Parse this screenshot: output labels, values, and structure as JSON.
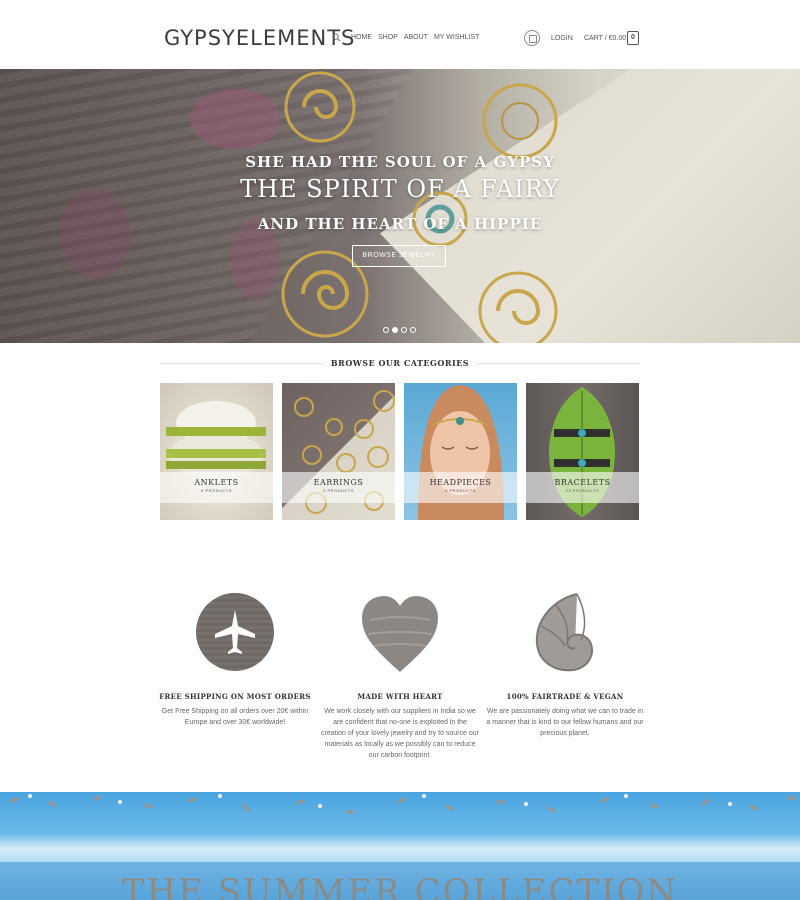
{
  "header": {
    "logo": "GYPSYELEMENTS",
    "nav": [
      "HOME",
      "SHOP",
      "ABOUT",
      "MY WISHLIST"
    ],
    "login": "LOGIN",
    "cart": "CART / €0.00",
    "cart_count": "0"
  },
  "hero": {
    "line1": "SHE HAD THE SOUL OF A GYPSY",
    "line2": "THE SPIRIT OF A FAIRY",
    "line3": "AND THE HEART OF A HIPPIE",
    "button": "BROWSE JEWELRY",
    "slides": 4,
    "active_slide": 2
  },
  "categories": {
    "title": "BROWSE OUR CATEGORIES",
    "items": [
      {
        "name": "ANKLETS",
        "count": "6 PRODUCTS"
      },
      {
        "name": "EARRINGS",
        "count": "3 PRODUCTS"
      },
      {
        "name": "HEADPIECES",
        "count": "0 PRODUCTS"
      },
      {
        "name": "BRACELETS",
        "count": "22 PRODUCTS"
      }
    ]
  },
  "features": [
    {
      "icon": "airplane-icon",
      "title": "FREE SHIPPING ON MOST ORDERS",
      "text": "Get Free Shipping on all orders over 20€ within Europe and over 30€ worldwide!"
    },
    {
      "icon": "heart-icon",
      "title": "MADE WITH HEART",
      "text": "We work closely with our suppliers in India so we are confident that no-one is exploited in the creation of your lovely jewelry and try to source our materials as locally as we possibly can to reduce our carbon footprint."
    },
    {
      "icon": "nautilus-shell-icon",
      "title": "100% FAIRTRADE & VEGAN",
      "text": "We are passionately doing what we can to trade in a manner that is kind to our fellow humans and our precious planet."
    }
  ],
  "banner": {
    "title": "THE SUMMER COLLECTION"
  }
}
